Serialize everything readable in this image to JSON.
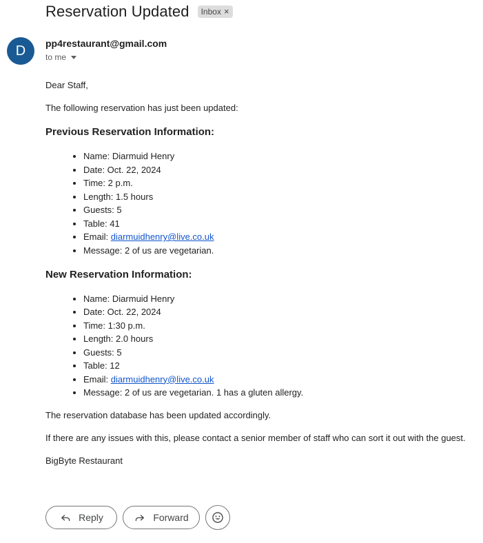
{
  "email": {
    "subject": "Reservation Updated",
    "label": "Inbox",
    "label_remove": "×",
    "avatar_letter": "D",
    "avatar_color": "#1a5a94",
    "sender": "pp4restaurant@gmail.com",
    "recipient": "to me"
  },
  "body": {
    "greeting": "Dear Staff,",
    "intro": "The following reservation has just been updated:",
    "previous_heading": "Previous Reservation Information:",
    "previous": {
      "name": "Name: Diarmuid Henry",
      "date": "Date: Oct. 22, 2024",
      "time": "Time: 2 p.m.",
      "length": "Length: 1.5 hours",
      "guests": "Guests: 5",
      "table": "Table: 41",
      "email_prefix": "Email: ",
      "email": "diarmuidhenry@live.co.uk",
      "message": "Message: 2 of us are vegetarian."
    },
    "new_heading": "New Reservation Information:",
    "new": {
      "name": "Name: Diarmuid Henry",
      "date": "Date: Oct. 22, 2024",
      "time": "Time: 1:30 p.m.",
      "length": "Length: 2.0 hours",
      "guests": "Guests: 5",
      "table": "Table: 12",
      "email_prefix": "Email: ",
      "email": "diarmuidhenry@live.co.uk",
      "message": "Message: 2 of us are vegetarian. 1 has a gluten allergy."
    },
    "db_note": "The reservation database has been updated accordingly.",
    "issues_note": "If there are any issues with this, please contact a senior member of staff who can sort it out with the guest.",
    "signature": "BigByte Restaurant"
  },
  "actions": {
    "reply_label": "Reply",
    "reply_icon": "reply-icon",
    "forward_label": "Forward",
    "forward_icon": "forward-icon",
    "emoji_icon": "emoji-icon"
  }
}
